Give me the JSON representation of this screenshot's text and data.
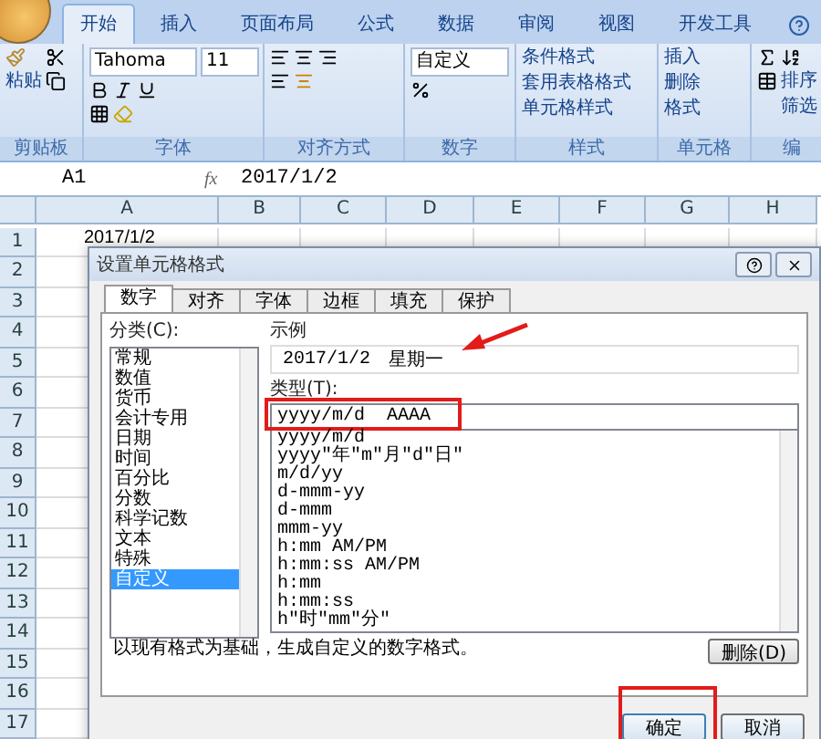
{
  "ribbon": {
    "tabs": [
      {
        "label": "开始",
        "selected": true
      },
      {
        "label": "插入",
        "selected": false
      },
      {
        "label": "页面布局",
        "selected": false
      },
      {
        "label": "公式",
        "selected": false
      },
      {
        "label": "数据",
        "selected": false
      },
      {
        "label": "审阅",
        "selected": false
      },
      {
        "label": "视图",
        "selected": false
      },
      {
        "label": "开发工具",
        "selected": false
      }
    ],
    "clipboard": {
      "paste": "粘贴",
      "label": "剪贴板"
    },
    "font": {
      "name": "Tahoma",
      "size": "11",
      "label": "字体"
    },
    "alignment": {
      "label": "对齐方式"
    },
    "number": {
      "format": "自定义",
      "label": "数字"
    },
    "styles": {
      "items": [
        "条件格式",
        "套用表格格式",
        "单元格样式"
      ],
      "label": "样式"
    },
    "cells": {
      "items": [
        "插入",
        "删除",
        "格式"
      ],
      "label": "单元格"
    },
    "editing": {
      "sort": "排序",
      "filter": "筛选",
      "label": "编"
    }
  },
  "formula_bar": {
    "cell": "A1",
    "function_label": "fx",
    "value": "2017/1/2"
  },
  "sheet": {
    "columns": [
      "A",
      "B",
      "C",
      "D",
      "E",
      "F",
      "G",
      "H"
    ],
    "rows": [
      {
        "number": "1",
        "a": "2017/1/2"
      },
      {
        "number": "2"
      },
      {
        "number": "3"
      },
      {
        "number": "4"
      },
      {
        "number": "5"
      },
      {
        "number": "6"
      },
      {
        "number": "7"
      },
      {
        "number": "8"
      },
      {
        "number": "9"
      },
      {
        "number": "10"
      },
      {
        "number": "11"
      },
      {
        "number": "12"
      },
      {
        "number": "13"
      },
      {
        "number": "14"
      },
      {
        "number": "15"
      },
      {
        "number": "16"
      },
      {
        "number": "17"
      }
    ]
  },
  "dialog": {
    "title": "设置单元格格式",
    "tabs": [
      {
        "label": "数字",
        "selected": true
      },
      {
        "label": "对齐",
        "selected": false
      },
      {
        "label": "字体",
        "selected": false
      },
      {
        "label": "边框",
        "selected": false
      },
      {
        "label": "填充",
        "selected": false
      },
      {
        "label": "保护",
        "selected": false
      }
    ],
    "category_label": "分类(C):",
    "categories": [
      {
        "label": "常规",
        "selected": false
      },
      {
        "label": "数值",
        "selected": false
      },
      {
        "label": "货币",
        "selected": false
      },
      {
        "label": "会计专用",
        "selected": false
      },
      {
        "label": "日期",
        "selected": false
      },
      {
        "label": "时间",
        "selected": false
      },
      {
        "label": "百分比",
        "selected": false
      },
      {
        "label": "分数",
        "selected": false
      },
      {
        "label": "科学记数",
        "selected": false
      },
      {
        "label": "文本",
        "selected": false
      },
      {
        "label": "特殊",
        "selected": false
      },
      {
        "label": "自定义",
        "selected": true
      }
    ],
    "sample_label": "示例",
    "sample_value": "2017/1/2",
    "sample_weekday": "星期一",
    "type_label": "类型(T):",
    "type_value": "yyyy/m/d  AAAA",
    "formats": [
      "yyyy/m/d",
      "yyyy\"年\"m\"月\"d\"日\"",
      "m/d/yy",
      "d-mmm-yy",
      "d-mmm",
      "mmm-yy",
      "h:mm AM/PM",
      "h:mm:ss AM/PM",
      "h:mm",
      "h:mm:ss",
      "h\"时\"mm\"分\""
    ],
    "delete_button": "删除(D)",
    "description": "以现有格式为基础，生成自定义的数字格式。",
    "ok": "确定",
    "cancel": "取消"
  }
}
